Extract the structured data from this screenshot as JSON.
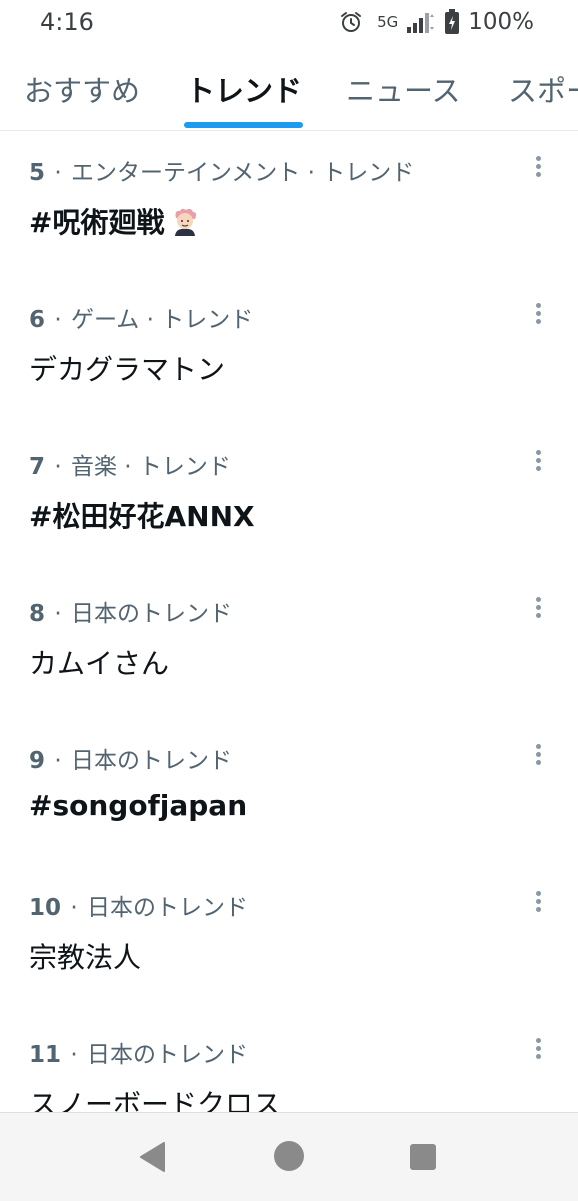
{
  "status_bar": {
    "time": "4:16",
    "network": "5G",
    "battery": "100%"
  },
  "tabs": [
    {
      "label": "おすすめ",
      "active": false
    },
    {
      "label": "トレンド",
      "active": true
    },
    {
      "label": "ニュース",
      "active": false
    },
    {
      "label": "スポー",
      "active": false
    }
  ],
  "trends": [
    {
      "rank": "5",
      "category": "エンターテインメント · トレンド",
      "title": "#呪術廻戦",
      "bold": true,
      "has_emoji": true
    },
    {
      "rank": "6",
      "category": "ゲーム · トレンド",
      "title": "デカグラマトン",
      "bold": false,
      "has_emoji": false
    },
    {
      "rank": "7",
      "category": "音楽 · トレンド",
      "title": "#松田好花ANNX",
      "bold": true,
      "has_emoji": false
    },
    {
      "rank": "8",
      "category": "日本のトレンド",
      "title": "カムイさん",
      "bold": false,
      "has_emoji": false
    },
    {
      "rank": "9",
      "category": "日本のトレンド",
      "title": "#songofjapan",
      "bold": true,
      "has_emoji": false
    },
    {
      "rank": "10",
      "category": "日本のトレンド",
      "title": "宗教法人",
      "bold": false,
      "has_emoji": false
    },
    {
      "rank": "11",
      "category": "日本のトレンド",
      "title": "スノーボードクロス",
      "bold": false,
      "has_emoji": false
    }
  ],
  "colors": {
    "accent": "#1d9bf0",
    "meta_text": "#536471",
    "primary_text": "#0f1419"
  },
  "icons": {
    "alarm": "alarm-icon",
    "signal": "signal-icon",
    "battery": "battery-icon",
    "more": "more-vertical-icon",
    "emoji": "character-emoji-icon",
    "nav_back": "back-triangle-icon",
    "nav_home": "home-circle-icon",
    "nav_recent": "recent-apps-square-icon"
  }
}
